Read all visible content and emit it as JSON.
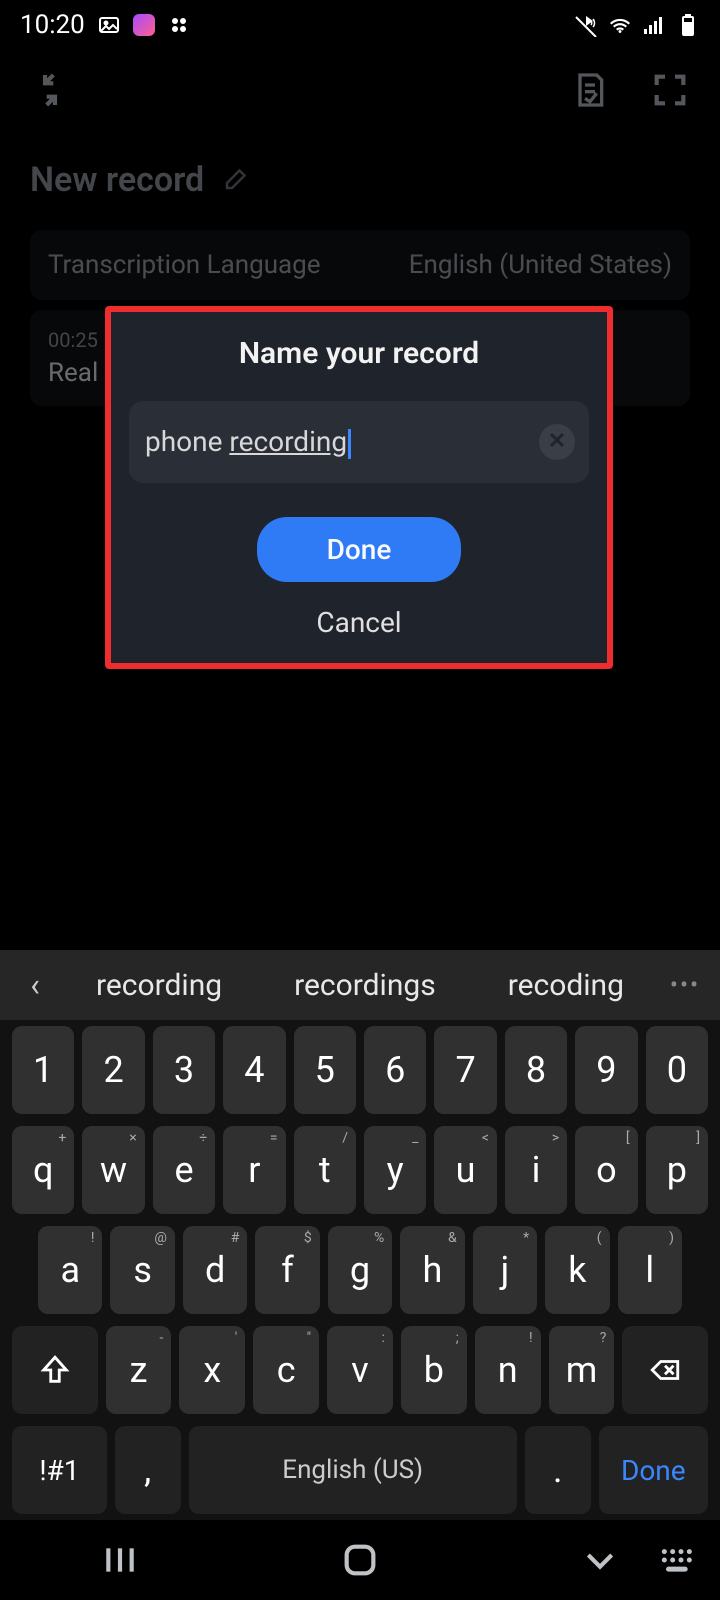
{
  "status": {
    "time": "10:20"
  },
  "header": {
    "title": "New record",
    "transcription_label": "Transcription Language",
    "transcription_value": "English (United States)",
    "clip_time": "00:25",
    "clip_title": "Real"
  },
  "modal": {
    "title": "Name your record",
    "input_value_prefix": "phone ",
    "input_value_underlined": "recording",
    "done_label": "Done",
    "cancel_label": "Cancel"
  },
  "keyboard": {
    "suggestions": [
      "recording",
      "recordings",
      "recoding"
    ],
    "row_numbers": [
      "1",
      "2",
      "3",
      "4",
      "5",
      "6",
      "7",
      "8",
      "9",
      "0"
    ],
    "row_q": [
      "q",
      "w",
      "e",
      "r",
      "t",
      "y",
      "u",
      "i",
      "o",
      "p"
    ],
    "row_q_sup": [
      "+",
      "×",
      "÷",
      "=",
      "/",
      "_",
      "<",
      ">",
      "[",
      "]"
    ],
    "row_a": [
      "a",
      "s",
      "d",
      "f",
      "g",
      "h",
      "j",
      "k",
      "l"
    ],
    "row_a_sup": [
      "!",
      "@",
      "#",
      "$",
      "%",
      "&",
      "*",
      "(",
      ")"
    ],
    "row_z": [
      "z",
      "x",
      "c",
      "v",
      "b",
      "n",
      "m"
    ],
    "row_z_sup": [
      "-",
      "'",
      "\"",
      ":",
      ";",
      "!",
      "?"
    ],
    "sym_label": "!#1",
    "comma": ",",
    "space_label": "English (US)",
    "period": ".",
    "done_key": "Done"
  }
}
